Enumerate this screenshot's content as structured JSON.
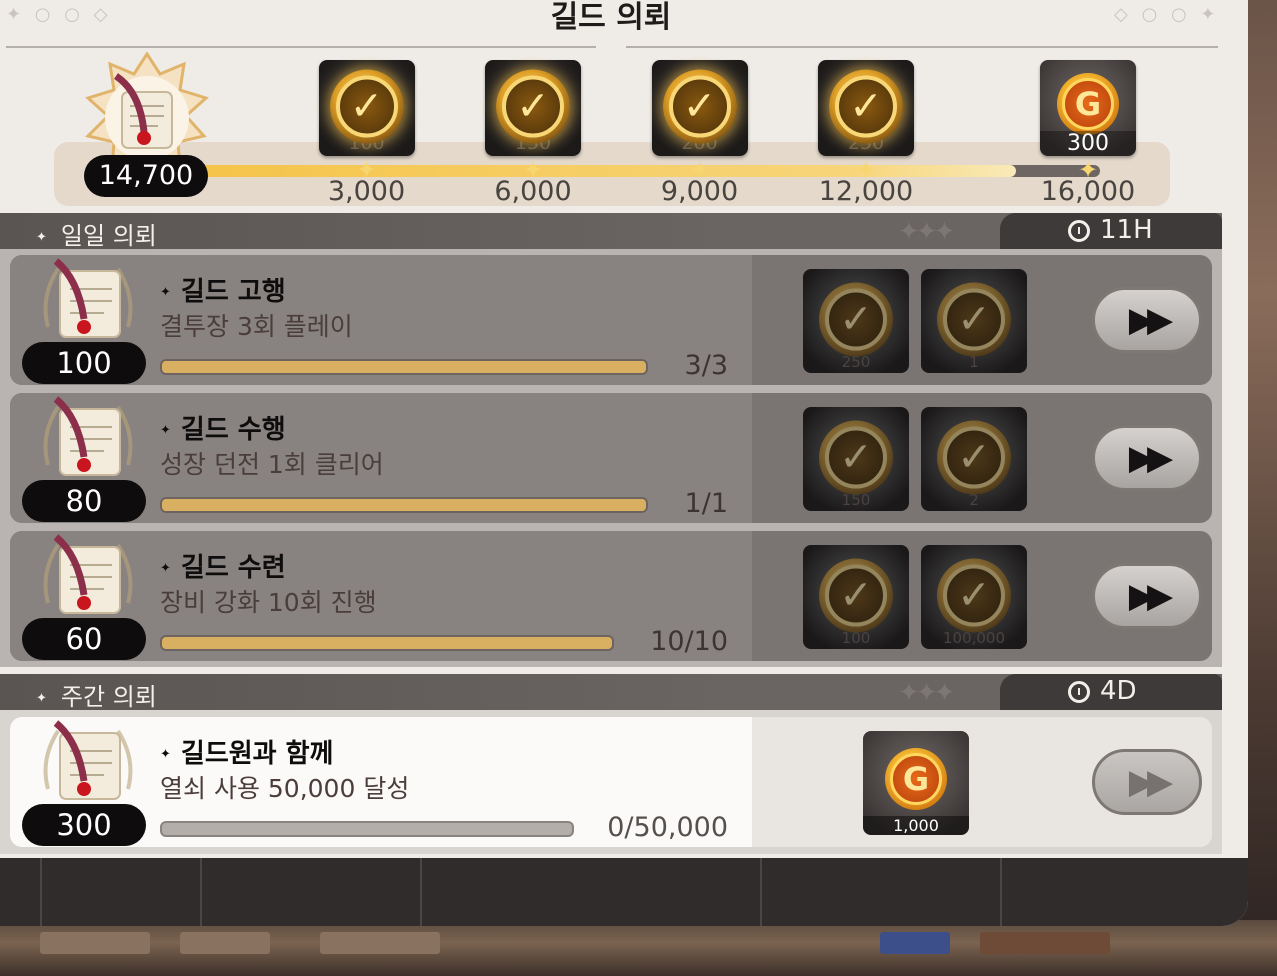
{
  "title": "길드 의뢰",
  "progress": {
    "current_score": "14,700",
    "current_value": 14700,
    "max_value": 16000,
    "milestones": [
      {
        "label": "3,000",
        "value": 3000,
        "reward_icon": "check-icon",
        "claimed": true,
        "sub": "100"
      },
      {
        "label": "6,000",
        "value": 6000,
        "reward_icon": "check-icon",
        "claimed": true,
        "sub": "150"
      },
      {
        "label": "9,000",
        "value": 9000,
        "reward_icon": "check-icon",
        "claimed": true,
        "sub": "200"
      },
      {
        "label": "12,000",
        "value": 12000,
        "reward_icon": "check-icon",
        "claimed": true,
        "sub": "250"
      },
      {
        "label": "16,000",
        "value": 16000,
        "reward_icon": "gold-coin-icon",
        "claimed": false,
        "amount": "300"
      }
    ]
  },
  "daily": {
    "title": "일일 의뢰",
    "timer": "11H",
    "quests": [
      {
        "points": "100",
        "name": "길드 고행",
        "desc": "결투장 3회 플레이",
        "progress": "3/3",
        "ratio": 1.0,
        "rewards": [
          {
            "icon": "check-icon",
            "sub": "250"
          },
          {
            "icon": "check-icon",
            "sub": "1"
          }
        ]
      },
      {
        "points": "80",
        "name": "길드 수행",
        "desc": "성장 던전 1회 클리어",
        "progress": "1/1",
        "ratio": 1.0,
        "rewards": [
          {
            "icon": "check-icon",
            "sub": "150"
          },
          {
            "icon": "check-icon",
            "sub": "2"
          }
        ]
      },
      {
        "points": "60",
        "name": "길드 수련",
        "desc": "장비 강화 10회 진행",
        "progress": "10/10",
        "ratio": 1.0,
        "rewards": [
          {
            "icon": "check-icon",
            "sub": "100"
          },
          {
            "icon": "check-icon",
            "sub": "100,000"
          }
        ]
      }
    ]
  },
  "weekly": {
    "title": "주간 의뢰",
    "timer": "4D",
    "quests": [
      {
        "points": "300",
        "name": "길드원과 함께",
        "desc": "열쇠 사용 50,000 달성",
        "progress": "0/50,000",
        "ratio": 0.0,
        "rewards": [
          {
            "icon": "gold-coin-icon",
            "amount": "1,000"
          }
        ]
      }
    ]
  },
  "colors": {
    "accent_gold": "#f5c449",
    "panel": "#efece8",
    "header": "#5a5452"
  }
}
